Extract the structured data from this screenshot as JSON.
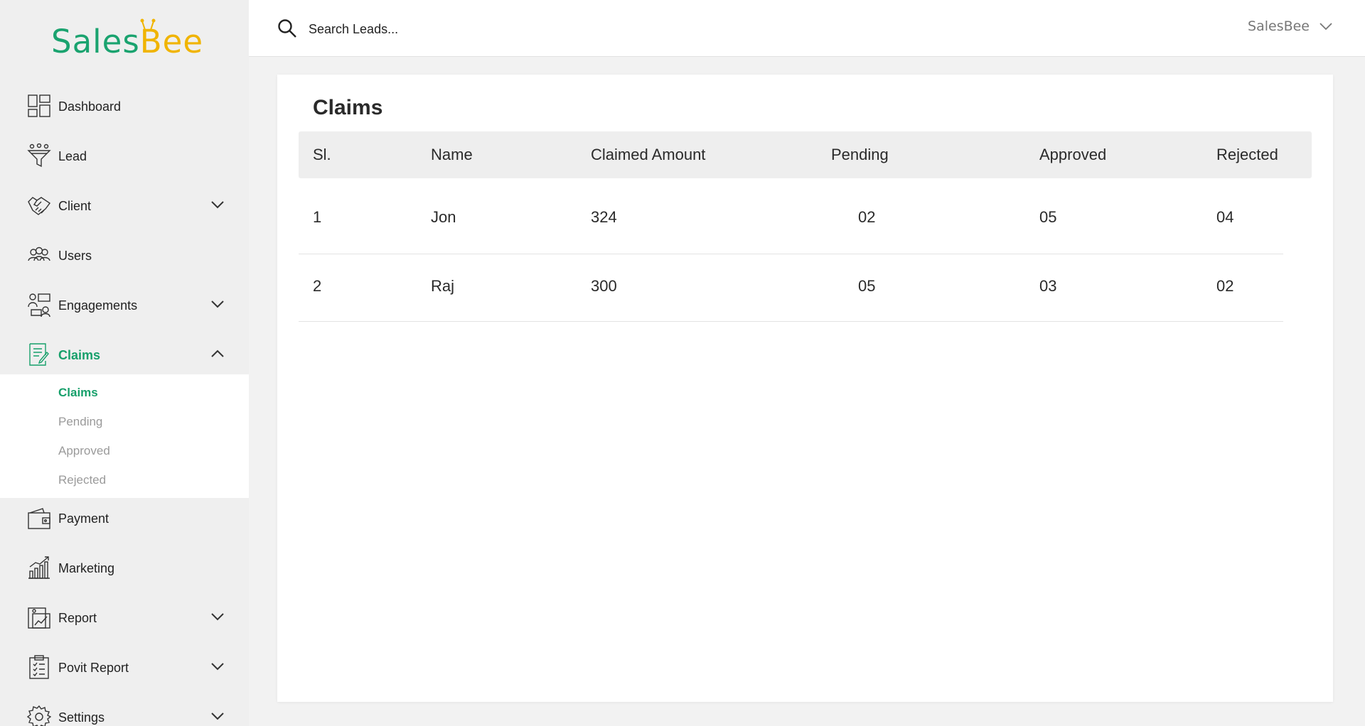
{
  "brand": {
    "logo_sales": "Sales",
    "logo_bee": "Bee",
    "accent": "#17a06b",
    "logo_yellow": "#f0b400"
  },
  "search": {
    "placeholder": "Search Leads..."
  },
  "user": {
    "name": "SalesBee"
  },
  "sidebar": {
    "items": [
      {
        "label": "Dashboard",
        "icon": "dashboard-icon"
      },
      {
        "label": "Lead",
        "icon": "funnel-icon"
      },
      {
        "label": "Client",
        "icon": "handshake-icon",
        "expandable": true
      },
      {
        "label": "Users",
        "icon": "users-icon"
      },
      {
        "label": "Engagements",
        "icon": "engagements-icon",
        "expandable": true
      },
      {
        "label": "Claims",
        "icon": "claims-icon",
        "expandable": true,
        "expanded": true,
        "active": true
      },
      {
        "label": "Payment",
        "icon": "wallet-icon"
      },
      {
        "label": "Marketing",
        "icon": "chart-icon"
      },
      {
        "label": "Report",
        "icon": "report-icon",
        "expandable": true
      },
      {
        "label": "Povit Report",
        "icon": "clipboard-icon",
        "expandable": true
      },
      {
        "label": "Settings",
        "icon": "gear-icon",
        "expandable": true
      }
    ],
    "claims_submenu": [
      {
        "label": "Claims",
        "active": true
      },
      {
        "label": "Pending"
      },
      {
        "label": "Approved"
      },
      {
        "label": "Rejected"
      }
    ]
  },
  "main": {
    "title": "Claims",
    "table": {
      "columns": [
        "Sl.",
        "Name",
        "Claimed Amount",
        "Pending",
        "Approved",
        "Rejected"
      ],
      "rows": [
        [
          "1",
          "Jon",
          "324",
          "02",
          "05",
          "04"
        ],
        [
          "2",
          "Raj",
          "300",
          "05",
          "03",
          "02"
        ]
      ]
    }
  }
}
